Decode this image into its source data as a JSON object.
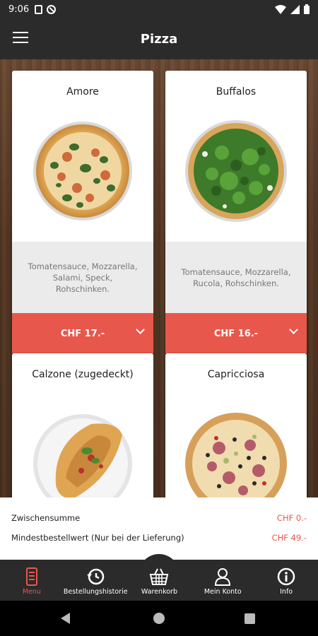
{
  "status_bar": {
    "time": "9:06"
  },
  "app_bar": {
    "title": "Pizza",
    "menu_icon": "hamburger-menu-icon"
  },
  "products": [
    {
      "name": "Amore",
      "description": "Tomatensauce, Mozzarella, Salami, Speck, Rohschinken.",
      "price": "CHF 17.-"
    },
    {
      "name": "Buffalos",
      "description": "Tomatensauce, Mozzarella, Rucola, Rohschinken.",
      "price": "CHF 16.-"
    },
    {
      "name": "Calzone (zugedeckt)"
    },
    {
      "name": "Capricciosa"
    }
  ],
  "summary": {
    "subtotal_label": "Zwischensumme",
    "subtotal_value": "CHF 0.-",
    "minimum_label": "Mindestbestellwert (Nur bei der Lieferung)",
    "minimum_value": "CHF 49.-"
  },
  "bottom_nav": {
    "items": [
      {
        "label": "Menu",
        "icon": "menu-phone-icon",
        "active": true
      },
      {
        "label": "Bestellungshistorie",
        "icon": "history-icon"
      },
      {
        "label": "Warenkorb",
        "icon": "basket-icon"
      },
      {
        "label": "Mein Konto",
        "icon": "account-icon"
      },
      {
        "label": "Info",
        "icon": "info-icon"
      }
    ]
  },
  "colors": {
    "accent": "#e8574b",
    "bar": "#2b2b2b",
    "card_desc_bg": "#ebebeb"
  }
}
